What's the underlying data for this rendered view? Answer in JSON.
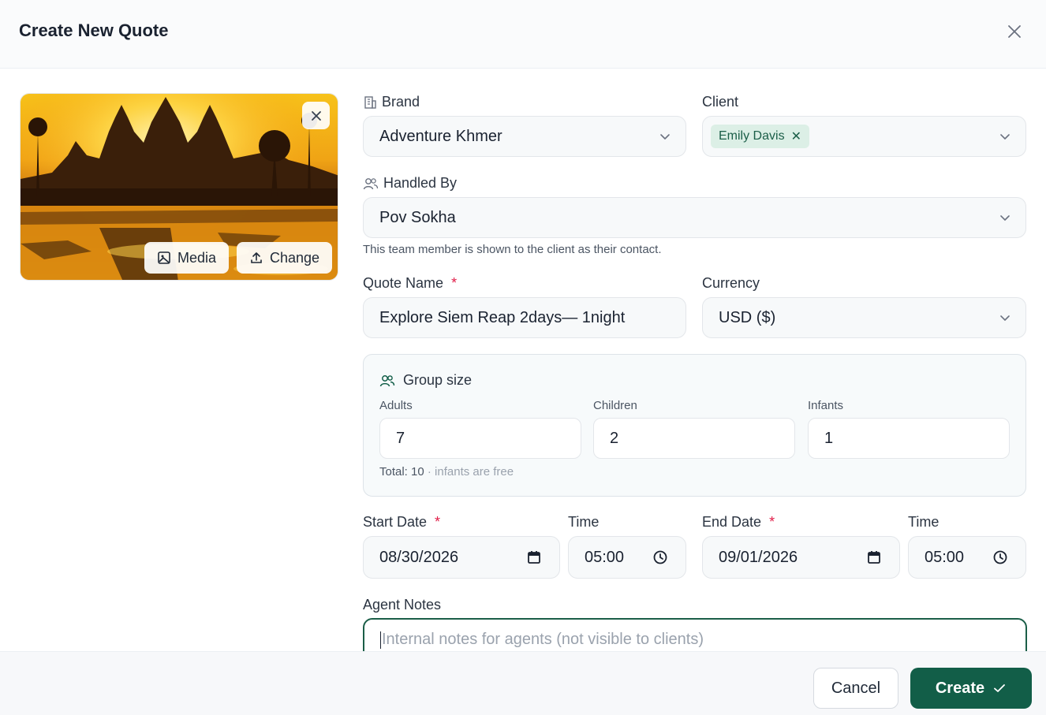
{
  "dialog": {
    "title": "Create New Quote"
  },
  "cover": {
    "media_label": "Media",
    "change_label": "Change"
  },
  "brand": {
    "label": "Brand",
    "value": "Adventure Khmer"
  },
  "client": {
    "label": "Client",
    "chip": "Emily Davis"
  },
  "handled_by": {
    "label": "Handled By",
    "value": "Pov Sokha",
    "hint": "This team member is shown to the client as their contact."
  },
  "quote_name": {
    "label": "Quote Name",
    "required": "*",
    "value": "Explore Siem Reap 2days— 1night"
  },
  "currency": {
    "label": "Currency",
    "value": "USD ($)"
  },
  "group_size": {
    "title": "Group size",
    "adults": {
      "label": "Adults",
      "value": "7"
    },
    "children": {
      "label": "Children",
      "value": "2"
    },
    "infants": {
      "label": "Infants",
      "value": "1"
    },
    "total": "Total: 10",
    "total_note": "· infants are free"
  },
  "start_date": {
    "label": "Start Date",
    "required": "*",
    "value": "08/30/2026"
  },
  "start_time": {
    "label": "Time",
    "value": "05:00"
  },
  "end_date": {
    "label": "End Date",
    "required": "*",
    "value": "09/01/2026"
  },
  "end_time": {
    "label": "Time",
    "value": "05:00"
  },
  "agent_notes": {
    "label": "Agent Notes",
    "placeholder": "Internal notes for agents (not visible to clients)"
  },
  "footer": {
    "cancel_label": "Cancel",
    "create_label": "Create"
  },
  "colors": {
    "primary": "#125e48",
    "chip_bg": "#dcefe6",
    "required": "#e11d48"
  }
}
